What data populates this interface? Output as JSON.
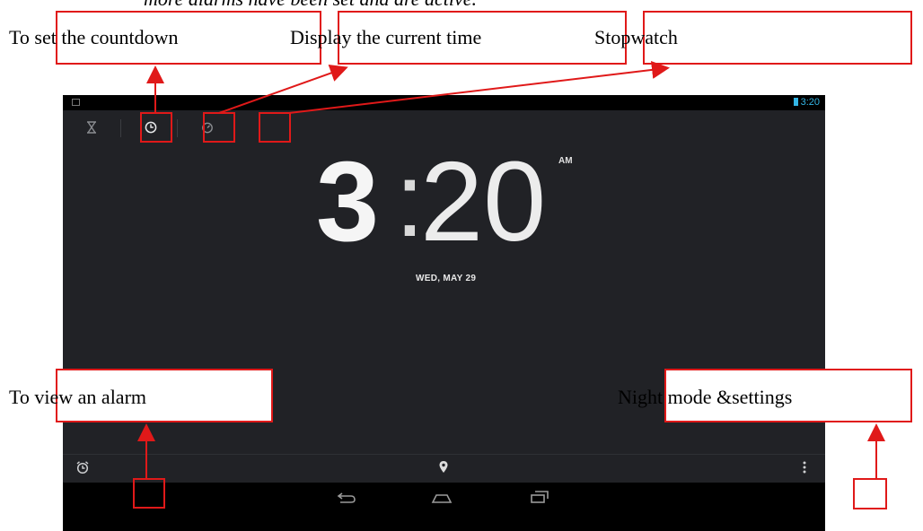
{
  "caption": "more alarms have been set and are active.",
  "screen": {
    "status_time": "3:20",
    "clock": {
      "hour": "3",
      "colon": ":",
      "minutes": "20",
      "ampm": "AM"
    },
    "date": "WED, MAY 29",
    "tabs": [
      {
        "icon": "hourglass-icon",
        "glyph": "⌛",
        "active": false
      },
      {
        "icon": "clock-icon",
        "glyph": "◷",
        "active": true
      },
      {
        "icon": "stopwatch-icon",
        "glyph": "◔",
        "active": false
      }
    ],
    "bottom": {
      "alarm_icon": "alarm-clock-icon",
      "location_icon": "map-pin-icon",
      "menu_icon": "overflow-menu-icon"
    },
    "nav": {
      "back": "⮌",
      "home": "⌂",
      "recents": "❐"
    }
  },
  "annotations": {
    "countdown": "To set the countdown",
    "current_time": "Display the current time",
    "stopwatch": "Stopwatch",
    "view_alarm": "To view an alarm",
    "night_mode": "Night mode &settings"
  },
  "colors": {
    "annotation": "#e01919",
    "screen_bg": "#212226",
    "accent": "#33b5e5"
  }
}
